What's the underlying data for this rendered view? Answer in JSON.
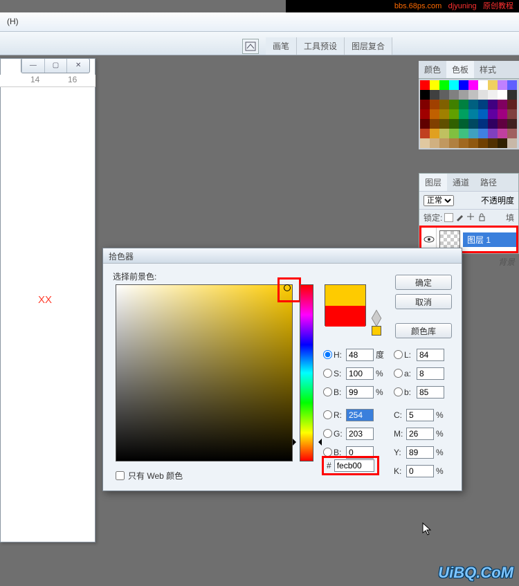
{
  "top_links": {
    "a": "bbs.68ps.com",
    "b": "djyuning",
    "c": "原创教程"
  },
  "menu": {
    "help": "(H)"
  },
  "tool_tabs": {
    "brush": "画笔",
    "presets": "工具预设",
    "layercomp": "图层复合"
  },
  "ruler": {
    "m14": "14",
    "m16": "16"
  },
  "xx": "XX",
  "swatch_tabs": {
    "color": "颜色",
    "swatches": "色板",
    "styles": "样式"
  },
  "swatch_rows": [
    [
      "#ff0000",
      "#ffff00",
      "#00ff00",
      "#00ffff",
      "#0000ff",
      "#ff00ff",
      "#ffffff",
      "#f0d060",
      "#c080ff",
      "#6060ff"
    ],
    [
      "#000000",
      "#404040",
      "#606060",
      "#808080",
      "#a0a0a0",
      "#c0c0c0",
      "#e0e0e0",
      "#f0f0f0",
      "#ffffff",
      "#303030"
    ],
    [
      "#800000",
      "#a04000",
      "#806000",
      "#408000",
      "#008040",
      "#006080",
      "#004080",
      "#400080",
      "#800060",
      "#602020"
    ],
    [
      "#a00000",
      "#c06000",
      "#a08000",
      "#60a000",
      "#00a060",
      "#0080a0",
      "#0060c0",
      "#6000a0",
      "#a00080",
      "#804040"
    ],
    [
      "#600000",
      "#804000",
      "#605000",
      "#306000",
      "#006030",
      "#004860",
      "#003080",
      "#300060",
      "#600040",
      "#402020"
    ],
    [
      "#c04020",
      "#e0a020",
      "#c0c060",
      "#80c040",
      "#40c080",
      "#40a0c0",
      "#4080e0",
      "#8040c0",
      "#c040a0",
      "#a06060"
    ],
    [
      "#e0c8a0",
      "#d0b080",
      "#c09860",
      "#b08040",
      "#a06820",
      "#8f5810",
      "#704000",
      "#503000",
      "#302000",
      "#c8b8a8"
    ]
  ],
  "layers_tabs": {
    "layers": "图层",
    "channels": "通道",
    "paths": "路径"
  },
  "layers": {
    "blend": "正常",
    "opacity_label": "不透明度",
    "fill_label": "填",
    "lock_label": "锁定:",
    "layer1": "图层 1",
    "bg": "背景"
  },
  "picker": {
    "title": "拾色器",
    "fg_label": "选择前景色:",
    "ok": "确定",
    "cancel": "取消",
    "lib": "颜色库",
    "H": "H:",
    "S": "S:",
    "B": "B:",
    "R": "R:",
    "G": "G:",
    "Bl": "B:",
    "L": "L:",
    "a": "a:",
    "b": "b:",
    "C": "C:",
    "M": "M:",
    "Y": "Y:",
    "K": "K:",
    "deg": "度",
    "pct": "%",
    "vals": {
      "H": "48",
      "S": "100",
      "B": "99",
      "R": "254",
      "G": "203",
      "Bl": "0",
      "L": "84",
      "a": "8",
      "b": "85",
      "C": "5",
      "M": "26",
      "Y": "89",
      "K": "0"
    },
    "hex_label": "#",
    "hex": "fecb00",
    "webonly": "只有 Web 颜色"
  },
  "watermark": "UiBQ.CoM"
}
